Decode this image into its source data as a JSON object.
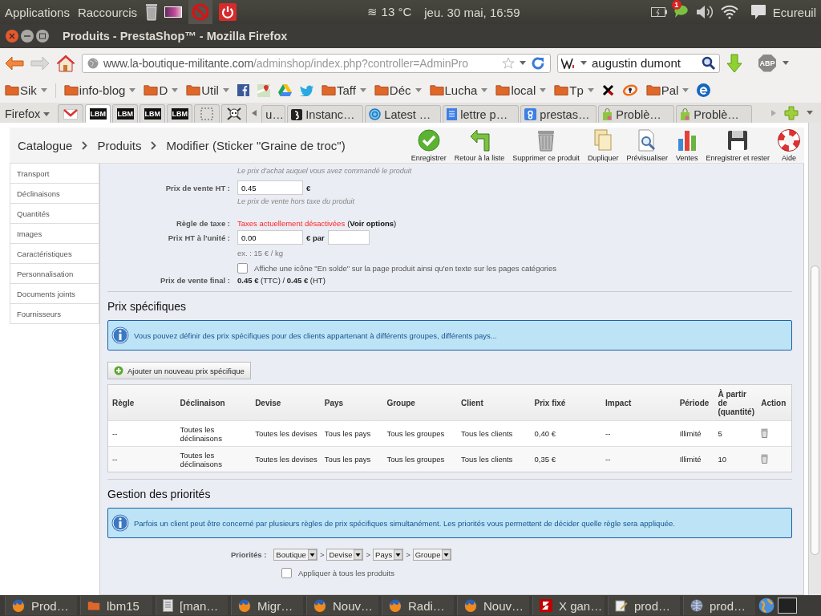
{
  "top_panel": {
    "menus": [
      "Applications",
      "Raccourcis"
    ],
    "launchers": [
      {
        "kind": "trash"
      },
      {
        "kind": "picture"
      },
      {
        "kind": "forbidden"
      },
      {
        "kind": "power"
      }
    ],
    "weather_symbol": "≋",
    "weather": "13 °C",
    "clock": "jeu. 30 mai, 16:59",
    "notification_count": "1",
    "user": "Ecureuil"
  },
  "window": {
    "title": "Produits - PrestaShop™ - Mozilla Firefox"
  },
  "navigation": {
    "url_host": "www.la-boutique-militante.com",
    "url_path": "/adminshop/index.php?controller=AdminPro",
    "search_value": "augustin dumont",
    "adblock_label": "ABP"
  },
  "bookmarks": [
    {
      "kind": "folder",
      "label": "Sik"
    },
    {
      "kind": "folder",
      "label": "info-blog"
    },
    {
      "kind": "folder",
      "label": "D"
    },
    {
      "kind": "folder",
      "label": "Util"
    },
    {
      "kind": "facebook"
    },
    {
      "kind": "maps"
    },
    {
      "kind": "drive"
    },
    {
      "kind": "bird"
    },
    {
      "kind": "folder",
      "label": "Taff"
    },
    {
      "kind": "folder",
      "label": "Déc"
    },
    {
      "kind": "folder",
      "label": "Lucha"
    },
    {
      "kind": "folder",
      "label": "local"
    },
    {
      "kind": "folder",
      "label": "Tp"
    },
    {
      "kind": "cross"
    },
    {
      "kind": "ring"
    },
    {
      "kind": "folder",
      "label": "Pal"
    },
    {
      "kind": "globe-e"
    }
  ],
  "tabs": {
    "menu_label": "Firefox",
    "pinned": [
      {
        "kind": "mail",
        "selected": false
      },
      {
        "kind": "lbm",
        "label": "LBM",
        "selected": true
      },
      {
        "kind": "lbm",
        "label": "LBM",
        "selected": false
      },
      {
        "kind": "lbm",
        "label": "LBM",
        "selected": false
      },
      {
        "kind": "lbm",
        "label": "LBM",
        "selected": false
      },
      {
        "kind": "dotted",
        "selected": false
      },
      {
        "kind": "skull",
        "selected": false
      }
    ],
    "items": [
      {
        "label": "u…",
        "kind": "none",
        "selected": false
      },
      {
        "label": "Instanc…",
        "kind": "dark",
        "selected": false
      },
      {
        "label": "Latest …",
        "kind": "swirl",
        "selected": false
      },
      {
        "label": "lettre p…",
        "kind": "doc",
        "selected": false
      },
      {
        "label": "prestas…",
        "kind": "g",
        "selected": false
      },
      {
        "label": "Problè…",
        "kind": "bag",
        "selected": false
      },
      {
        "label": "Problè…",
        "kind": "bag",
        "selected": false
      }
    ]
  },
  "toolbar": {
    "breadcrumb": [
      "Catalogue",
      "Produits",
      "Modifier (Sticker \"Graine de troc\")"
    ],
    "actions": [
      {
        "kind": "save",
        "label": "Enregistrer"
      },
      {
        "kind": "back",
        "label": "Retour à la liste"
      },
      {
        "kind": "delete",
        "label": "Supprimer ce produit"
      },
      {
        "kind": "duplicate",
        "label": "Dupliquer"
      },
      {
        "kind": "preview",
        "label": "Prévisualiser"
      },
      {
        "kind": "stats",
        "label": "Ventes"
      },
      {
        "kind": "save-stay",
        "label": "Enregistrer et rester"
      },
      {
        "kind": "help",
        "label": "Aide"
      }
    ]
  },
  "sidebar": {
    "items": [
      {
        "label": "Transport",
        "selected": false
      },
      {
        "label": "Déclinaisons",
        "selected": false
      },
      {
        "label": "Quantités",
        "selected": false
      },
      {
        "label": "Images",
        "selected": false
      },
      {
        "label": "Caractéristiques",
        "selected": false
      },
      {
        "label": "Personnalisation",
        "selected": false
      },
      {
        "label": "Documents joints",
        "selected": false
      },
      {
        "label": "Fournisseurs",
        "selected": false
      }
    ]
  },
  "form": {
    "purchase_hint": "Le prix d'achat auquel vous avez commandé le produit",
    "rows": [
      {
        "kind": "input",
        "label": "Prix de vente HT :",
        "value": "0.45",
        "unit": "€",
        "hint": "Le prix de vente hors taxe du produit"
      },
      {
        "kind": "tax",
        "label": "Règle de taxe :",
        "warning": "Taxes actuellement désactivées",
        "link": "(**Voir options**)"
      },
      {
        "kind": "unit",
        "label": "Prix HT à l'unité :",
        "value": "0.00",
        "unit": "€ par",
        "hint": "ex. : 15 € / kg"
      },
      {
        "kind": "checkbox",
        "text": "Affiche une icône \"En solde\" sur la page produit ainsi qu'en texte sur les pages catégories",
        "checked": false
      },
      {
        "kind": "final",
        "label": "Prix de vente final :",
        "text": "**0.45 €** (TTC) / **0.45 €** (HT)"
      }
    ]
  },
  "specific_prices": {
    "title": "Prix spécifiques",
    "info": "Vous pouvez définir des prix spécifiques pour des clients appartenant à différents groupes, différents pays...",
    "add_button": "Ajouter un nouveau prix spécifique",
    "table": {
      "columns": [
        "Règle",
        "Déclinaison",
        "Devise",
        "Pays",
        "Groupe",
        "Client",
        "Prix fixé",
        "Impact",
        "Période",
        "À partir de (quantité)",
        "Action"
      ],
      "rows": [
        [
          "--",
          "Toutes les déclinaisons",
          "Toutes les devises",
          "Tous les pays",
          "Tous les groupes",
          "Tous les clients",
          "0,40 €",
          "--",
          "Illimité",
          "5"
        ],
        [
          "--",
          "Toutes les déclinaisons",
          "Toutes les devises",
          "Tous les pays",
          "Tous les groupes",
          "Tous les clients",
          "0,35 €",
          "--",
          "Illimité",
          "10"
        ]
      ]
    }
  },
  "priorities": {
    "title": "Gestion des priorités",
    "info": "Parfois un client peut être concerné par plusieurs règles de prix spécifiques simultanément. Les priorités vous permettent de décider quelle règle sera appliquée.",
    "label": "Priorités :",
    "selects": [
      "Boutique",
      "Devise",
      "Pays",
      "Groupe"
    ],
    "separator": ">",
    "apply_label": "Appliquer à tous les produits",
    "apply_checked": false
  },
  "taskbar": [
    {
      "kind": "firefox",
      "label": "Prod…"
    },
    {
      "kind": "folder",
      "label": "lbm15"
    },
    {
      "kind": "doc",
      "label": "[man…"
    },
    {
      "kind": "firefox",
      "label": "Migr…"
    },
    {
      "kind": "firefox",
      "label": "Nouv…"
    },
    {
      "kind": "firefox",
      "label": "Radi…"
    },
    {
      "kind": "firefox",
      "label": "Nouv…"
    },
    {
      "kind": "filezilla",
      "label": "X gan…"
    },
    {
      "kind": "editor",
      "label": "prod…"
    },
    {
      "kind": "sphere",
      "label": "prod…"
    }
  ]
}
